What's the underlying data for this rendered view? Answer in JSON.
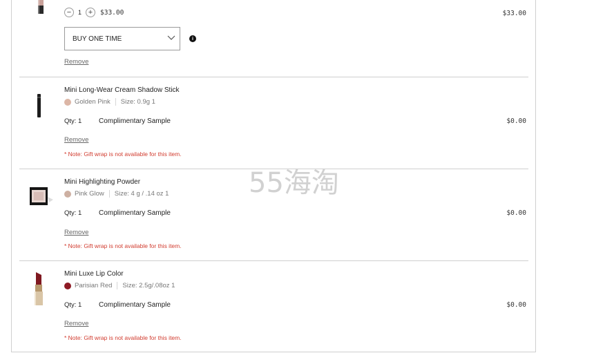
{
  "item0": {
    "qty_value": "1",
    "unit_price": "$33.00",
    "line_total": "$33.00",
    "purchase_option": "BUY ONE TIME",
    "remove_label": "Remove",
    "info_glyph": "i"
  },
  "items": [
    {
      "name": "Mini Long-Wear Cream Shadow Stick",
      "shade": "Golden Pink",
      "shade_color": "#dcb6a6",
      "size": "Size: 0.9g 1",
      "qty": "Qty: 1",
      "complimentary": "Complimentary Sample",
      "price": "$0.00",
      "remove_label": "Remove",
      "note": "* Note: Gift wrap is not available for this item.",
      "icon": "shadow-stick-thumbnail"
    },
    {
      "name": "Mini Highlighting Powder",
      "shade": "Pink Glow",
      "shade_color": "#cdb0a2",
      "size": "Size: 4 g / .14 oz 1",
      "qty": "Qty: 1",
      "complimentary": "Complimentary Sample",
      "price": "$0.00",
      "remove_label": "Remove",
      "note": "* Note: Gift wrap is not available for this item.",
      "icon": "compact-thumbnail"
    },
    {
      "name": "Mini Luxe Lip Color",
      "shade": "Parisian Red",
      "shade_color": "#8e1b25",
      "size": "Size: 2.5g/.08oz 1",
      "qty": "Qty: 1",
      "complimentary": "Complimentary Sample",
      "price": "$0.00",
      "remove_label": "Remove",
      "note": "* Note: Gift wrap is not available for this item.",
      "icon": "lipstick-thumbnail"
    }
  ],
  "watermark": "55海淘"
}
